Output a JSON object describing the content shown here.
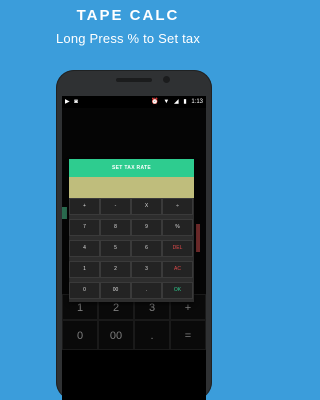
{
  "promo": {
    "title": "TAPE CALC",
    "subtitle": "Long Press % to Set tax"
  },
  "statusbar": {
    "time": "1:13",
    "left_icons": [
      "play-icon",
      "voicemail-icon"
    ],
    "right_icons": [
      "alarm-icon",
      "wifi-icon",
      "signal-icon",
      "battery-icon"
    ]
  },
  "dialog": {
    "set_tax_label": "SET TAX RATE",
    "tax_value": ""
  },
  "keypad": {
    "rows": [
      [
        "+",
        "-",
        "X",
        "÷"
      ],
      [
        "7",
        "8",
        "9",
        "%"
      ],
      [
        "4",
        "5",
        "6",
        "DEL"
      ],
      [
        "1",
        "2",
        "3",
        "AC"
      ],
      [
        "0",
        "00",
        ".",
        "OK"
      ]
    ]
  },
  "background_keys": {
    "row1": [
      "1",
      "2",
      "3"
    ],
    "row2": [
      "0",
      "00",
      ".",
      "+",
      "="
    ]
  },
  "colors": {
    "page_bg": "#3b9ddb",
    "accent_green": "#2ecc8f",
    "tax_field": "#bfbd7c",
    "danger_red": "#e24a4a"
  }
}
